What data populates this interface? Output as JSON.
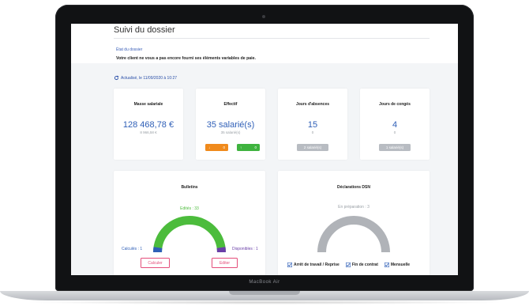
{
  "device": {
    "label": "MacBook Air"
  },
  "page": {
    "title": "Suivi du dossier",
    "status_label": "État du dossier",
    "status_text": "Votre client ne vous a pas encore fourni ses éléments variables de paie.",
    "refresh_text": "Actualisé, le 11/09/2020 à 10:27"
  },
  "kpis": [
    {
      "title": "Masse salariale",
      "value": "128 468,78 €",
      "sub": "8 966,58 €"
    },
    {
      "title": "Effectif",
      "value": "35 salarié(s)",
      "sub": "35 salarié(s)",
      "down_count": "0",
      "up_count": "0"
    },
    {
      "title": "Jours d'absences",
      "value": "15",
      "sub": "0",
      "pill": "2 salarié(s)"
    },
    {
      "title": "Jours de congés",
      "value": "4",
      "sub": "0",
      "pill": "1 salarié(s)"
    }
  ],
  "bulletins": {
    "title": "Bulletins",
    "edited_label": "Edités : 33",
    "calculated_label": "Calculés : 1",
    "available_label": "Disponibles : 1",
    "calculate_button": "Calculer",
    "edit_button": "Editer",
    "gauge": {
      "edited": 33,
      "calculated": 1,
      "available": 1
    }
  },
  "dsn": {
    "title": "Déclarations DSN",
    "preparing_label": "En préparation : 3",
    "gauge": {
      "preparing": 3
    },
    "checks": [
      {
        "label": "Arrêt de travail / Reprise",
        "checked": true
      },
      {
        "label": "Fin de contrat",
        "checked": true
      },
      {
        "label": "Mensuelle",
        "checked": true
      }
    ]
  },
  "colors": {
    "accent_blue": "#2f5fb7",
    "green": "#4cbc3c",
    "orange": "#f08a1c",
    "gray": "#b0b3b8",
    "pink": "#e44d7a"
  },
  "icons": [
    "refresh-icon",
    "arrow-down-icon",
    "arrow-up-icon",
    "checkbox-icon"
  ]
}
